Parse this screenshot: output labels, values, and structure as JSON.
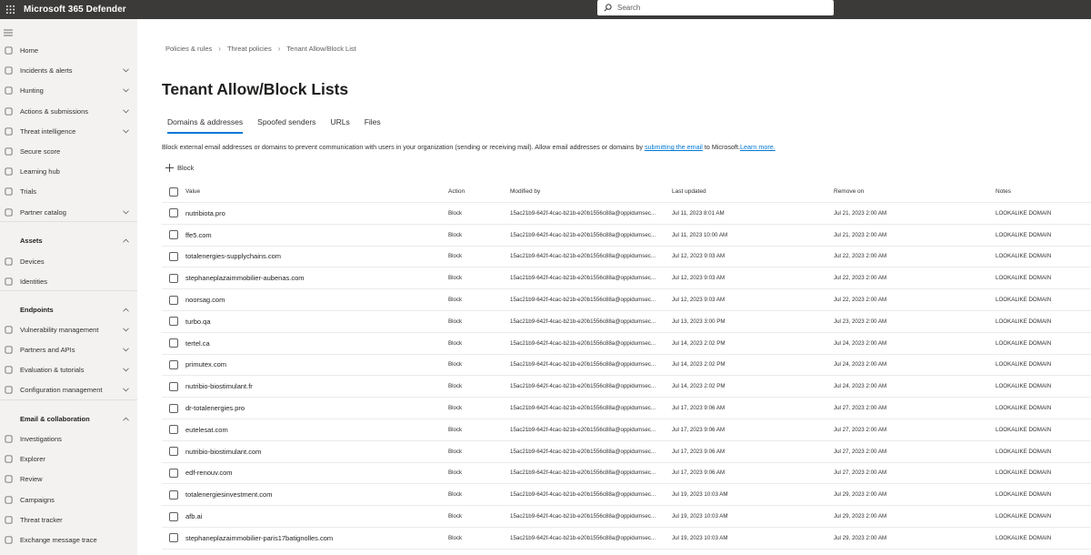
{
  "topbar": {
    "app_title": "Microsoft 365 Defender",
    "search_placeholder": "Search",
    "background": "#3b3a39"
  },
  "sidebar": {
    "items": [
      {
        "label": "Home",
        "icon": "home-icon",
        "chevron": false,
        "section": false
      },
      {
        "label": "Incidents & alerts",
        "icon": "shield-alert-icon",
        "chevron": true,
        "section": false
      },
      {
        "label": "Hunting",
        "icon": "hunting-icon",
        "chevron": true,
        "section": false
      },
      {
        "label": "Actions & submissions",
        "icon": "actions-icon",
        "chevron": true,
        "section": false
      },
      {
        "label": "Threat intelligence",
        "icon": "threat-intel-icon",
        "chevron": true,
        "section": false
      },
      {
        "label": "Secure score",
        "icon": "trophy-icon",
        "chevron": false,
        "section": false
      },
      {
        "label": "Learning hub",
        "icon": "learning-icon",
        "chevron": false,
        "section": false
      },
      {
        "label": "Trials",
        "icon": "trials-icon",
        "chevron": false,
        "section": false
      },
      {
        "label": "Partner catalog",
        "icon": "partner-icon",
        "chevron": true,
        "section": false
      },
      {
        "label": "Assets",
        "icon": "",
        "chevron": true,
        "section": true
      },
      {
        "label": "Devices",
        "icon": "devices-icon",
        "chevron": false,
        "section": false
      },
      {
        "label": "Identities",
        "icon": "identities-icon",
        "chevron": false,
        "section": false
      },
      {
        "label": "Endpoints",
        "icon": "",
        "chevron": true,
        "section": true
      },
      {
        "label": "Vulnerability management",
        "icon": "vulnerability-icon",
        "chevron": true,
        "section": false
      },
      {
        "label": "Partners and APIs",
        "icon": "partners-apis-icon",
        "chevron": true,
        "section": false
      },
      {
        "label": "Evaluation & tutorials",
        "icon": "evaluation-icon",
        "chevron": true,
        "section": false
      },
      {
        "label": "Configuration management",
        "icon": "configuration-icon",
        "chevron": true,
        "section": false
      },
      {
        "label": "Email & collaboration",
        "icon": "",
        "chevron": true,
        "section": true
      },
      {
        "label": "Investigations",
        "icon": "investigations-icon",
        "chevron": false,
        "section": false
      },
      {
        "label": "Explorer",
        "icon": "explorer-icon",
        "chevron": false,
        "section": false
      },
      {
        "label": "Review",
        "icon": "review-icon",
        "chevron": false,
        "section": false
      },
      {
        "label": "Campaigns",
        "icon": "campaigns-icon",
        "chevron": false,
        "section": false
      },
      {
        "label": "Threat tracker",
        "icon": "threat-tracker-icon",
        "chevron": false,
        "section": false
      },
      {
        "label": "Exchange message trace",
        "icon": "message-trace-icon",
        "chevron": false,
        "section": false
      }
    ]
  },
  "breadcrumb": [
    "Policies & rules",
    "Threat policies",
    "Tenant Allow/Block List"
  ],
  "page_title": "Tenant Allow/Block Lists",
  "tabs": [
    {
      "label": "Domains & addresses",
      "active": true
    },
    {
      "label": "Spoofed senders",
      "active": false
    },
    {
      "label": "URLs",
      "active": false
    },
    {
      "label": "Files",
      "active": false
    }
  ],
  "description": {
    "text": "Block external email addresses or domains to prevent communication with users in your organization (sending or receiving mail). Allow email addresses or domains by ",
    "link": "submitting the email",
    "after": " to Microsoft.",
    "learn_more": "Learn more."
  },
  "block_button": "Block",
  "table": {
    "columns": [
      "Value",
      "Action",
      "Modified by",
      "Last updated",
      "Remove on",
      "Notes"
    ],
    "rows": [
      {
        "value": "nutribiota.pro",
        "action": "Block",
        "modified_by": "15ac21b9-642f-4cac-b21b-e20b1556c88a@oppidumsec...",
        "last_updated": "Jul 11, 2023 8:01 AM",
        "remove_on": "Jul 21, 2023 2:00 AM",
        "notes": "LOOKALIKE DOMAIN"
      },
      {
        "value": "ffe5.com",
        "action": "Block",
        "modified_by": "15ac21b9-642f-4cac-b21b-e20b1556c88a@oppidumsec...",
        "last_updated": "Jul 11, 2023 10:00 AM",
        "remove_on": "Jul 21, 2023 2:00 AM",
        "notes": "LOOKALIKE DOMAIN"
      },
      {
        "value": "totalenergies-supplychains.com",
        "action": "Block",
        "modified_by": "15ac21b9-642f-4cac-b21b-e20b1556c88a@oppidumsec...",
        "last_updated": "Jul 12, 2023 9:03 AM",
        "remove_on": "Jul 22, 2023 2:00 AM",
        "notes": "LOOKALIKE DOMAIN"
      },
      {
        "value": "stephaneplazaimmobilier-aubenas.com",
        "action": "Block",
        "modified_by": "15ac21b9-642f-4cac-b21b-e20b1556c88a@oppidumsec...",
        "last_updated": "Jul 12, 2023 9:03 AM",
        "remove_on": "Jul 22, 2023 2:00 AM",
        "notes": "LOOKALIKE DOMAIN"
      },
      {
        "value": "noorsag.com",
        "action": "Block",
        "modified_by": "15ac21b9-642f-4cac-b21b-e20b1556c88a@oppidumsec...",
        "last_updated": "Jul 12, 2023 9:03 AM",
        "remove_on": "Jul 22, 2023 2:00 AM",
        "notes": "LOOKALIKE DOMAIN"
      },
      {
        "value": "turbo.qa",
        "action": "Block",
        "modified_by": "15ac21b9-642f-4cac-b21b-e20b1556c88a@oppidumsec...",
        "last_updated": "Jul 13, 2023 3:00 PM",
        "remove_on": "Jul 23, 2023 2:00 AM",
        "notes": "LOOKALIKE DOMAIN"
      },
      {
        "value": "tertel.ca",
        "action": "Block",
        "modified_by": "15ac21b9-642f-4cac-b21b-e20b1556c88a@oppidumsec...",
        "last_updated": "Jul 14, 2023 2:02 PM",
        "remove_on": "Jul 24, 2023 2:00 AM",
        "notes": "LOOKALIKE DOMAIN"
      },
      {
        "value": "primutex.com",
        "action": "Block",
        "modified_by": "15ac21b9-642f-4cac-b21b-e20b1556c88a@oppidumsec...",
        "last_updated": "Jul 14, 2023 2:02 PM",
        "remove_on": "Jul 24, 2023 2:00 AM",
        "notes": "LOOKALIKE DOMAIN"
      },
      {
        "value": "nutribio-biostimulant.fr",
        "action": "Block",
        "modified_by": "15ac21b9-642f-4cac-b21b-e20b1556c88a@oppidumsec...",
        "last_updated": "Jul 14, 2023 2:02 PM",
        "remove_on": "Jul 24, 2023 2:00 AM",
        "notes": "LOOKALIKE DOMAIN"
      },
      {
        "value": "dr-totalenergies.pro",
        "action": "Block",
        "modified_by": "15ac21b9-642f-4cac-b21b-e20b1556c88a@oppidumsec...",
        "last_updated": "Jul 17, 2023 9:06 AM",
        "remove_on": "Jul 27, 2023 2:00 AM",
        "notes": "LOOKALIKE DOMAIN"
      },
      {
        "value": "eutelesat.com",
        "action": "Block",
        "modified_by": "15ac21b9-642f-4cac-b21b-e20b1556c88a@oppidumsec...",
        "last_updated": "Jul 17, 2023 9:06 AM",
        "remove_on": "Jul 27, 2023 2:00 AM",
        "notes": "LOOKALIKE DOMAIN"
      },
      {
        "value": "nutribio-biostimulant.com",
        "action": "Block",
        "modified_by": "15ac21b9-642f-4cac-b21b-e20b1556c88a@oppidumsec...",
        "last_updated": "Jul 17, 2023 9:06 AM",
        "remove_on": "Jul 27, 2023 2:00 AM",
        "notes": "LOOKALIKE DOMAIN"
      },
      {
        "value": "edf-renouv.com",
        "action": "Block",
        "modified_by": "15ac21b9-642f-4cac-b21b-e20b1556c88a@oppidumsec...",
        "last_updated": "Jul 17, 2023 9:06 AM",
        "remove_on": "Jul 27, 2023 2:00 AM",
        "notes": "LOOKALIKE DOMAIN"
      },
      {
        "value": "totalenergiesinvestment.com",
        "action": "Block",
        "modified_by": "15ac21b9-642f-4cac-b21b-e20b1556c88a@oppidumsec...",
        "last_updated": "Jul 19, 2023 10:03 AM",
        "remove_on": "Jul 29, 2023 2:00 AM",
        "notes": "LOOKALIKE DOMAIN"
      },
      {
        "value": "afb.ai",
        "action": "Block",
        "modified_by": "15ac21b9-642f-4cac-b21b-e20b1556c88a@oppidumsec...",
        "last_updated": "Jul 19, 2023 10:03 AM",
        "remove_on": "Jul 29, 2023 2:00 AM",
        "notes": "LOOKALIKE DOMAIN"
      },
      {
        "value": "stephaneplazaimmobilier-paris17batignolles.com",
        "action": "Block",
        "modified_by": "15ac21b9-642f-4cac-b21b-e20b1556c88a@oppidumsec...",
        "last_updated": "Jul 19, 2023 10:03 AM",
        "remove_on": "Jul 29, 2023 2:00 AM",
        "notes": "LOOKALIKE DOMAIN"
      }
    ]
  },
  "colors": {
    "accent": "#0078d4",
    "topbar": "#3b3a39",
    "sidebar": "#f3f2f1"
  }
}
